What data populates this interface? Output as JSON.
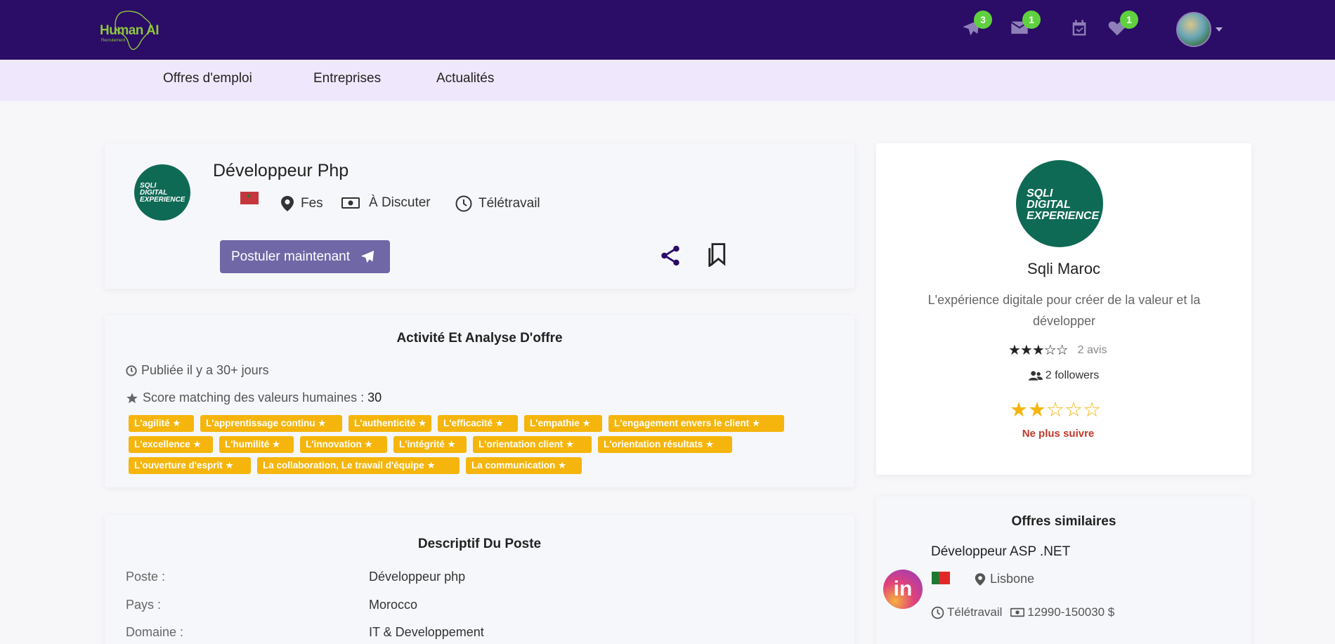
{
  "brand": {
    "logo_text": "Human AI",
    "logo_sub": "Recrutement"
  },
  "header": {
    "icons": [
      {
        "name": "send-icon",
        "badge": "3"
      },
      {
        "name": "mail-icon",
        "badge": "1"
      },
      {
        "name": "calendar-icon",
        "badge": ""
      },
      {
        "name": "heart-icon",
        "badge": "1"
      }
    ]
  },
  "nav": {
    "items": [
      "Offres d'emploi",
      "Entreprises",
      "Actualités"
    ]
  },
  "job": {
    "title": "Développeur Php",
    "location": "Fes",
    "salary": "À Discuter",
    "work_mode": "Télétravail",
    "apply_label": "Postuler maintenant",
    "company_logo_text": [
      "SQLI",
      "DIGITAL",
      "EXPERIENCE"
    ]
  },
  "activity": {
    "heading": "Activité Et Analyse D'offre",
    "published": "Publiée il y a 30+ jours",
    "score_label": "Score matching des valeurs humaines :",
    "score_value": "30",
    "tags": [
      "L'agilité",
      "L'apprentissage continu",
      "L'authenticité",
      "L'efficacité",
      "L'empathie",
      "L'engagement envers le client",
      "L'excellence",
      "L'humilité",
      "L'innovation",
      "L'intégrité",
      "L'orientation client",
      "L'orientation résultats",
      "L'ouverture d'esprit",
      "La collaboration, Le travail d'équipe",
      "La communication"
    ]
  },
  "description": {
    "heading": "Descriptif Du Poste",
    "rows": [
      {
        "label": "Poste :",
        "value": "Développeur php"
      },
      {
        "label": "Pays :",
        "value": "Morocco"
      },
      {
        "label": "Domaine :",
        "value": "IT & Developpement"
      }
    ]
  },
  "company": {
    "name": "Sqli Maroc",
    "tagline": "L'expérience digitale pour créer de la valeur et la développer",
    "rating": 3,
    "reviews": "2 avis",
    "followers": "2 followers",
    "user_rating": 2,
    "unfollow_label": "Ne plus suivre"
  },
  "similar": {
    "heading": "Offres similaires",
    "items": [
      {
        "title": "Développeur ASP .NET",
        "logo_text": "in",
        "location": "Lisbone",
        "work_mode": "Télétravail",
        "salary": "12990-150030 $"
      }
    ]
  }
}
